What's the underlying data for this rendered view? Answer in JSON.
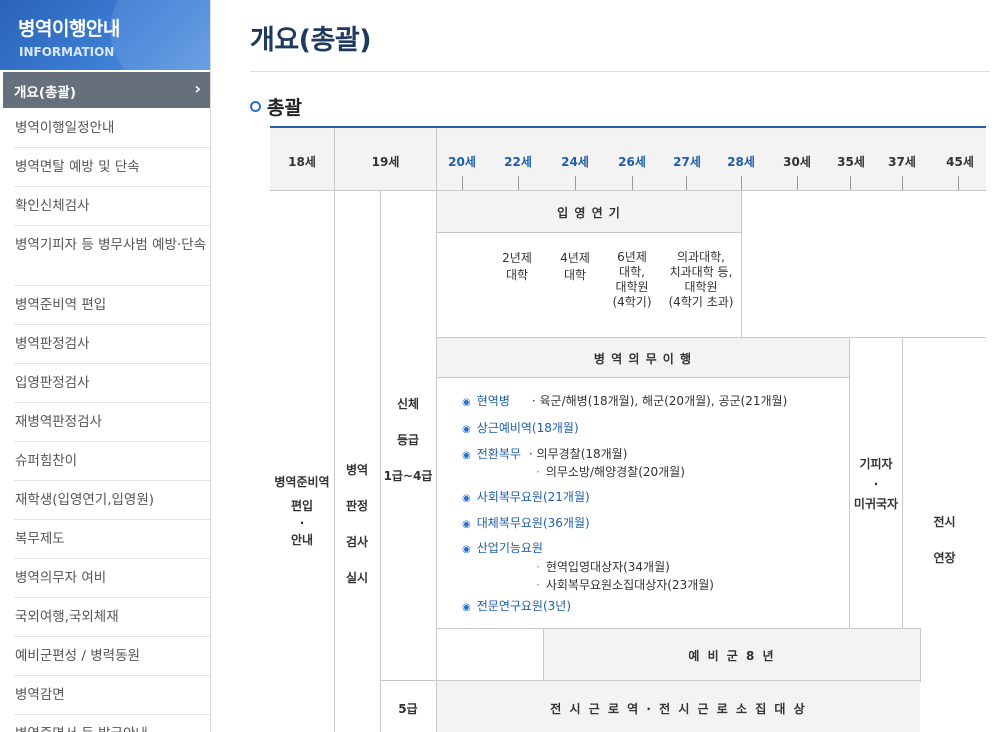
{
  "sidebar": {
    "title": "병역이행안내",
    "subtitle": "INFORMATION",
    "active_item": "개요(총괄)",
    "items": [
      "병역이행일정안내",
      "병역면탈 예방 및 단속",
      "확인신체검사",
      "병역기피자 등 병무사범 예방·단속",
      "병역준비역 편입",
      "병역판정검사",
      "입영판정검사",
      "재병역판정검사",
      "슈퍼힘찬이",
      "재학생(입영연기,입영원)",
      "복무제도",
      "병역의무자 여비",
      "국외여행,국외체재",
      "예비군편성 / 병력동원",
      "병역감면",
      "병역증명서 등 발급안내"
    ]
  },
  "main": {
    "page_title": "개요(총괄)",
    "section_title": "총괄"
  },
  "diagram": {
    "ages": [
      "18세",
      "19세",
      "20세",
      "22세",
      "24세",
      "26세",
      "27세",
      "28세",
      "30세",
      "35세",
      "37세",
      "45세"
    ],
    "highlight_color": "#1f5ea8",
    "col1": [
      "병역준비역",
      "편입",
      "·",
      "안내"
    ],
    "col2": [
      "병역",
      "판정",
      "검사",
      "실시"
    ],
    "col3": [
      "신체",
      "등급",
      "1급~4급"
    ],
    "enlist_delay": {
      "title": "입 영 연 기",
      "notes": [
        "2년제\n대학",
        "4년제\n대학",
        "6년제\n대학,\n대학원\n(4학기)",
        "의과대학,\n치과대학 등,\n대학원\n(4학기 초과)"
      ]
    },
    "duty": {
      "title": "병 역 의 무 이 행",
      "items": [
        {
          "name": "현역병",
          "detail": "· 육군/해병(18개월), 해군(20개월), 공군(21개월)"
        },
        {
          "name": "상근예비역(18개월)",
          "detail": ""
        },
        {
          "name": "전환복무",
          "detail": "· 의무경찰(18개월)",
          "sub": [
            "의무소방/해양경찰(20개월)"
          ]
        },
        {
          "name": "사회복무요원(21개월)",
          "detail": ""
        },
        {
          "name": "대체복무요원(36개월)",
          "detail": ""
        },
        {
          "name": "산업기능요원",
          "detail": "",
          "sub": [
            "현역입영대상자(34개월)",
            "사회복무요원소집대상자(23개월)"
          ]
        },
        {
          "name": "전문연구요원(3년)",
          "detail": ""
        }
      ]
    },
    "evaders": [
      "기피자",
      "·",
      "미귀국자"
    ],
    "wartime": [
      "전시",
      "연장"
    ],
    "reserve": "예 비 군 8 년",
    "grade5": "5급",
    "wartime_labor": "전 시 근 로 역 · 전 시 근 로 소 집 대 상"
  }
}
